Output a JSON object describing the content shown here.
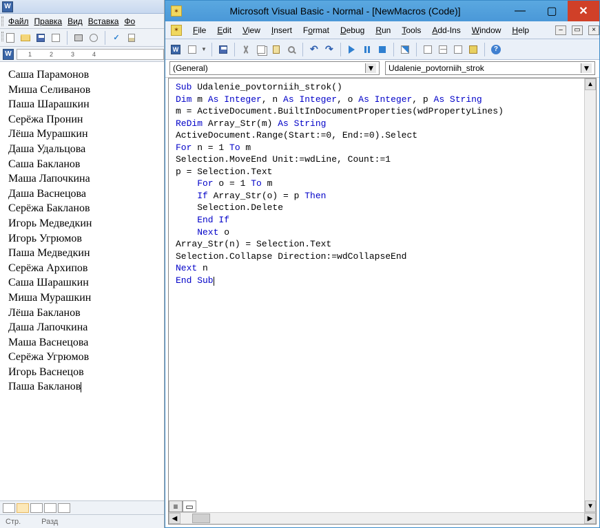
{
  "word": {
    "icon_text": "W",
    "menu": [
      "Файл",
      "Правка",
      "Вид",
      "Вставка",
      "Фо"
    ],
    "ruler_marks": [
      "1",
      "2",
      "3",
      "4"
    ],
    "names": [
      "Саша Парамонов",
      "Миша Селиванов",
      "Паша Шарашкин",
      "Серёжа Пронин",
      "Лёша Мурашкин",
      "Даша Удальцова",
      "Саша Бакланов",
      "Маша Лапочкина",
      "Даша Васнецова",
      "Серёжа Бакланов",
      "Игорь Медведкин",
      "Игорь Угрюмов",
      "Паша Медведкин",
      "Серёжа Архипов",
      "Саша Шарашкин",
      "Миша Мурашкин",
      "Лёша Бакланов",
      "Даша Лапочкина",
      "Маша Васнецова",
      "Серёжа Угрюмов",
      "Игорь Васнецов",
      "Паша Бакланов"
    ],
    "status": {
      "page_label": "Стр.",
      "sect_label": "Разд"
    }
  },
  "vba": {
    "title": "Microsoft Visual Basic - Normal - [NewMacros (Code)]",
    "menu": {
      "file": "File",
      "edit": "Edit",
      "view": "View",
      "insert": "Insert",
      "format": "Format",
      "debug": "Debug",
      "run": "Run",
      "tools": "Tools",
      "addins": "Add-Ins",
      "window": "Window",
      "help": "Help"
    },
    "dropdown_object": "(General)",
    "dropdown_proc": "Udalenie_povtorniih_strok",
    "code": {
      "l1a": "Sub",
      "l1b": " Udalenie_povtorniih_strok()",
      "l2a": "Dim",
      "l2b": " m ",
      "l2c": "As Integer",
      "l2d": ", n ",
      "l2e": "As Integer",
      "l2f": ", o ",
      "l2g": "As Integer",
      "l2h": ", p ",
      "l2i": "As String",
      "l3": "m = ActiveDocument.BuiltInDocumentProperties(wdPropertyLines)",
      "l4a": "ReDim",
      "l4b": " Array_Str(m) ",
      "l4c": "As String",
      "l5": "ActiveDocument.Range(Start:=0, End:=0).Select",
      "l6a": "For",
      "l6b": " n = 1 ",
      "l6c": "To",
      "l6d": " m",
      "l7": "Selection.MoveEnd Unit:=wdLine, Count:=1",
      "l8": "p = Selection.Text",
      "l9a": "    For",
      "l9b": " o = 1 ",
      "l9c": "To",
      "l9d": " m",
      "l10a": "    If",
      "l10b": " Array_Str(o) = p ",
      "l10c": "Then",
      "l11": "    Selection.Delete",
      "l12": "    End If",
      "l13a": "    Next",
      "l13b": " o",
      "l14": "Array_Str(n) = Selection.Text",
      "l15": "Selection.Collapse Direction:=wdCollapseEnd",
      "l16a": "Next",
      "l16b": " n",
      "l17": "End Sub"
    }
  }
}
